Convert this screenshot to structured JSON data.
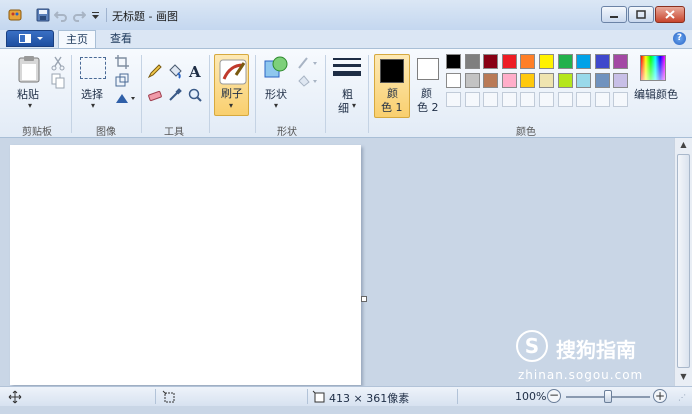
{
  "window": {
    "title": "无标题 - 画图"
  },
  "quick_access": {
    "icons": [
      "paint-app-icon",
      "save-icon",
      "undo-icon",
      "redo-icon",
      "customize-dropdown-icon"
    ]
  },
  "tabs": [
    {
      "label": "主页",
      "active": true
    },
    {
      "label": "查看",
      "active": false
    }
  ],
  "ribbon": {
    "clipboard": {
      "paste_label": "粘贴",
      "group_label": "剪贴板"
    },
    "image": {
      "select_label": "选择",
      "group_label": "图像"
    },
    "tools": {
      "group_label": "工具"
    },
    "brushes": {
      "label": "刷子"
    },
    "shapes": {
      "label": "形状",
      "group_label": "形状"
    },
    "size": {
      "label_top": "粗",
      "label_bottom": "细"
    },
    "color1": {
      "label_top": "颜",
      "label_bottom": "色 1",
      "color": "#000000"
    },
    "color2": {
      "label_top": "颜",
      "label_bottom": "色 2",
      "color": "#ffffff"
    },
    "colors": {
      "group_label": "颜色",
      "row1": [
        "#000000",
        "#7f7f7f",
        "#880015",
        "#ed1c24",
        "#ff7f27",
        "#fff200",
        "#22b14c",
        "#00a2e8",
        "#3f48cc",
        "#a349a4"
      ],
      "row2": [
        "#ffffff",
        "#c3c3c3",
        "#b97a57",
        "#ffaec9",
        "#ffc90e",
        "#efe4b0",
        "#b5e61d",
        "#99d9ea",
        "#7092be",
        "#c8bfe7"
      ],
      "row3_empty": 10
    },
    "edit_colors": {
      "label": "编辑颜色"
    }
  },
  "statusbar": {
    "canvas_size": "413 × 361像素",
    "zoom": "100%"
  },
  "watermark": {
    "brand": "搜狗指南",
    "url": "zhinan.sogou.com"
  }
}
